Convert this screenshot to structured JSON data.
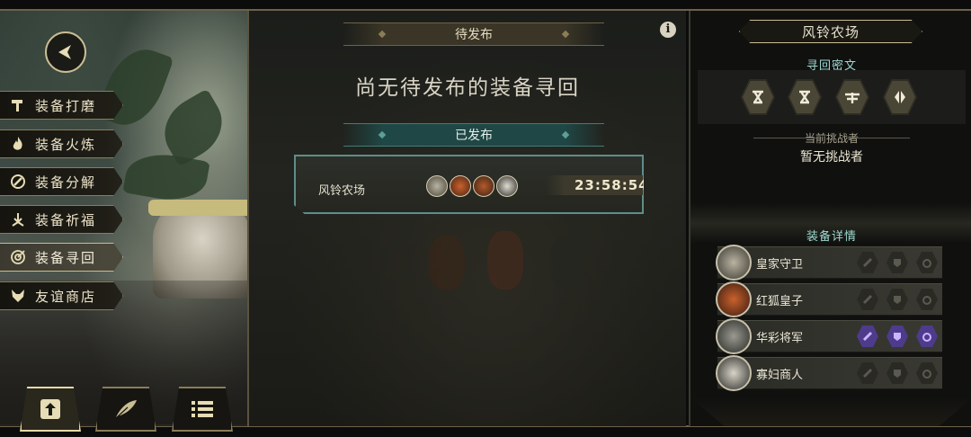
{
  "left_menu": {
    "items": [
      {
        "label": "装备打磨",
        "icon": "hammer-icon"
      },
      {
        "label": "装备火炼",
        "icon": "flame-icon"
      },
      {
        "label": "装备分解",
        "icon": "decompose-icon"
      },
      {
        "label": "装备祈福",
        "icon": "bless-icon"
      },
      {
        "label": "装备寻回",
        "icon": "target-icon",
        "active": true
      },
      {
        "label": "友谊商店",
        "icon": "fox-icon"
      }
    ],
    "bottom_buttons": [
      "upload-icon",
      "feather-icon",
      "list-icon"
    ]
  },
  "middle": {
    "pending_header": "待发布",
    "empty_message": "尚无待发布的装备寻回",
    "published_header": "已发布",
    "request_card": {
      "title": "风铃农场",
      "timer": "23:58:54"
    }
  },
  "right": {
    "title": "风铃农场",
    "cipher_label": "寻回密文",
    "cipher_icons": [
      "cipher-x-icon",
      "cipher-x-icon",
      "cipher-sword-icon",
      "cipher-split-icon"
    ],
    "challenger_label": "当前挑战者",
    "challenger_value": "暂无挑战者",
    "details_label": "装备详情",
    "heroes": [
      {
        "name": "皇家守卫",
        "color": "#b9b3a2",
        "lit": [
          false,
          false,
          false
        ]
      },
      {
        "name": "红狐皇子",
        "color": "#c9612d",
        "lit": [
          false,
          false,
          false
        ]
      },
      {
        "name": "华彩将军",
        "color": "#9a9a92",
        "lit": [
          true,
          true,
          true
        ]
      },
      {
        "name": "寡妇商人",
        "color": "#d8d4c8",
        "lit": [
          false,
          false,
          false
        ]
      }
    ]
  },
  "colors": {
    "accent_teal": "#5d8e8a",
    "gold_border": "#c9bd93",
    "purple_lit": "#4f3b8c"
  }
}
